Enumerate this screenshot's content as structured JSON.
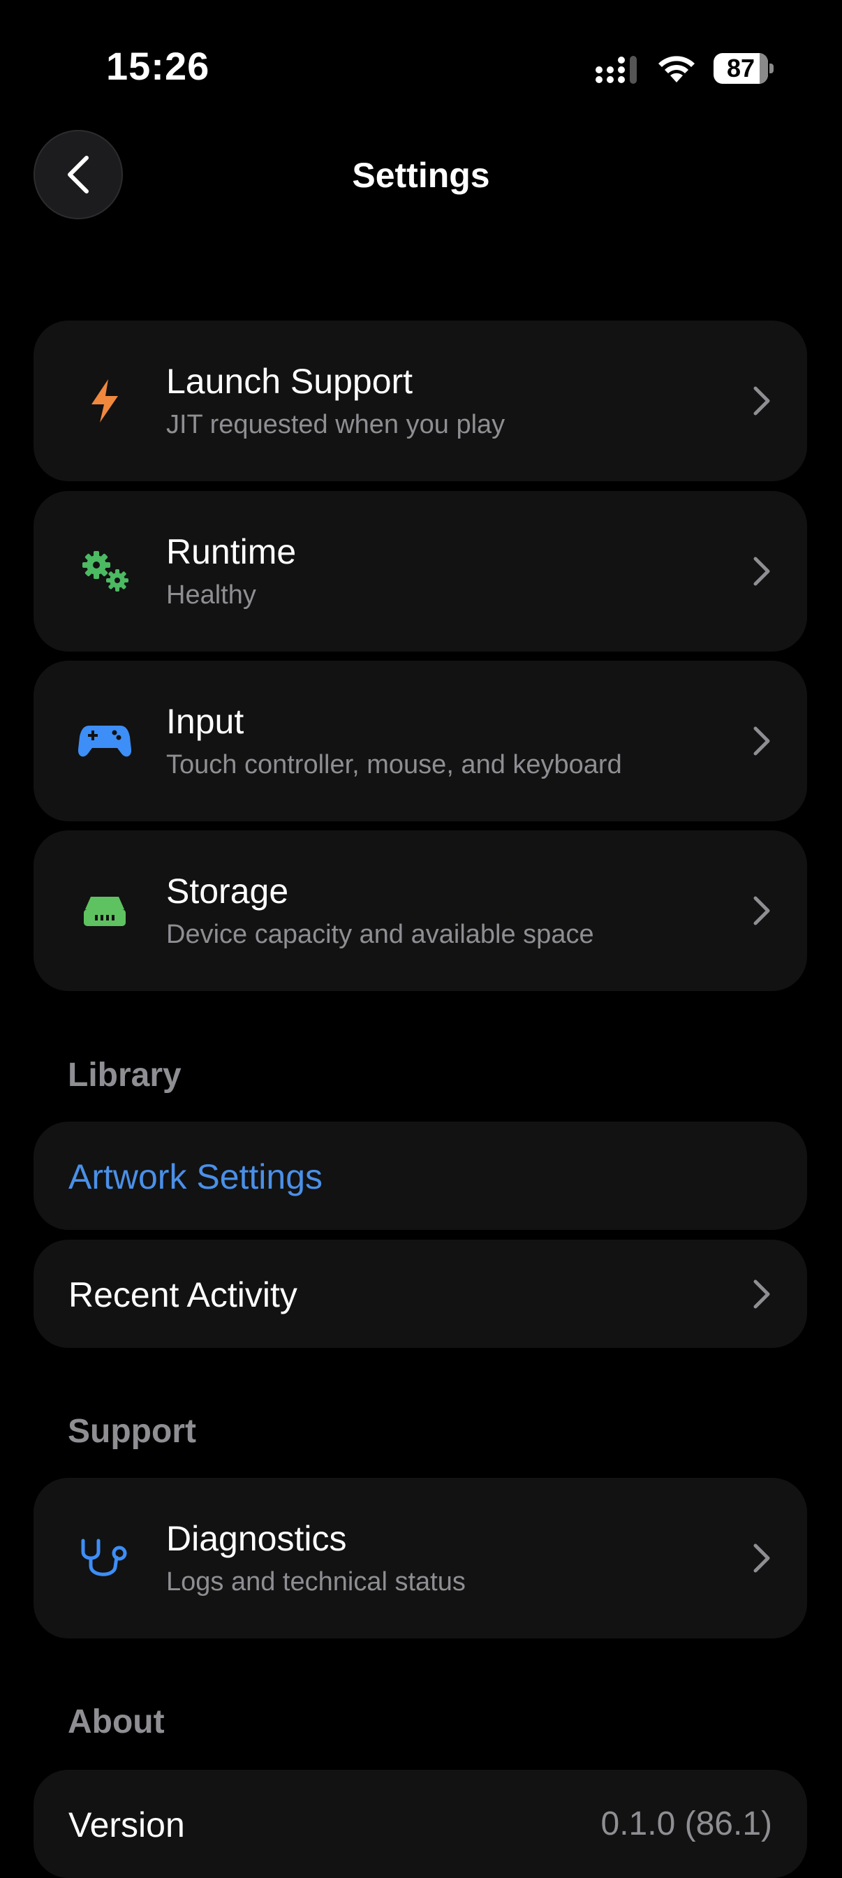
{
  "status_bar": {
    "time": "15:26",
    "battery_level": "87",
    "icons": [
      "signal-icon",
      "wifi-icon",
      "battery-icon"
    ]
  },
  "header": {
    "title": "Settings",
    "back_icon": "chevron-left-icon"
  },
  "settings_group": [
    {
      "title": "Launch Support",
      "subtitle": "JIT requested when you play",
      "icon": "lightning-bolt-icon",
      "icon_color": "#f0883e"
    },
    {
      "title": "Runtime",
      "subtitle": "Healthy",
      "icon": "gears-icon",
      "icon_color": "#4cb963"
    },
    {
      "title": "Input",
      "subtitle": "Touch controller, mouse, and keyboard",
      "icon": "gamepad-icon",
      "icon_color": "#3d8ef7"
    },
    {
      "title": "Storage",
      "subtitle": "Device capacity and available space",
      "icon": "drive-icon",
      "icon_color": "#5fc260"
    }
  ],
  "library": {
    "header": "Library",
    "artwork_label": "Artwork Settings",
    "artwork_color": "#4a90e8",
    "recent_label": "Recent Activity"
  },
  "support": {
    "header": "Support",
    "diagnostics_title": "Diagnostics",
    "diagnostics_subtitle": "Logs and technical status",
    "icon": "stethoscope-icon",
    "icon_color": "#3d8ef7"
  },
  "about": {
    "header": "About",
    "version_label": "Version",
    "version_value": "0.1.0 (86.1)"
  },
  "colors": {
    "background": "#000000",
    "card": "#121212",
    "secondary_text": "#8e8e93"
  }
}
